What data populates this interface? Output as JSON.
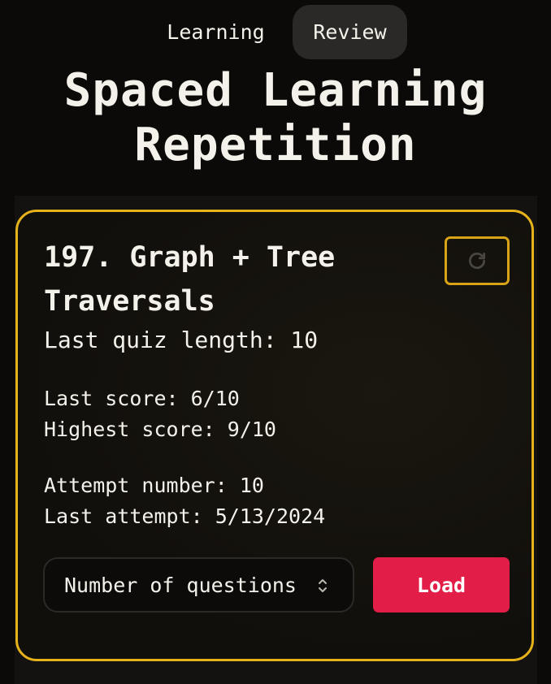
{
  "tabs": {
    "learning": "Learning",
    "review": "Review"
  },
  "title_line1": "Spaced Learning",
  "title_line2": "Repetition",
  "card": {
    "title_line1": "197. Graph + Tree",
    "title_line2": "Traversals",
    "last_quiz_length": "Last quiz length: 10",
    "last_score": "Last score: 6/10",
    "highest_score": "Highest score: 9/10",
    "attempt_number": "Attempt number: 10",
    "last_attempt": "Last attempt: 5/13/2024",
    "select_placeholder": "Number of questions",
    "load_label": "Load"
  },
  "icons": {
    "refresh": "refresh-icon",
    "select": "chevron-up-down-icon"
  },
  "colors": {
    "accent": "#e5b21a",
    "load": "#e11d48",
    "background": "#0b0a09"
  }
}
